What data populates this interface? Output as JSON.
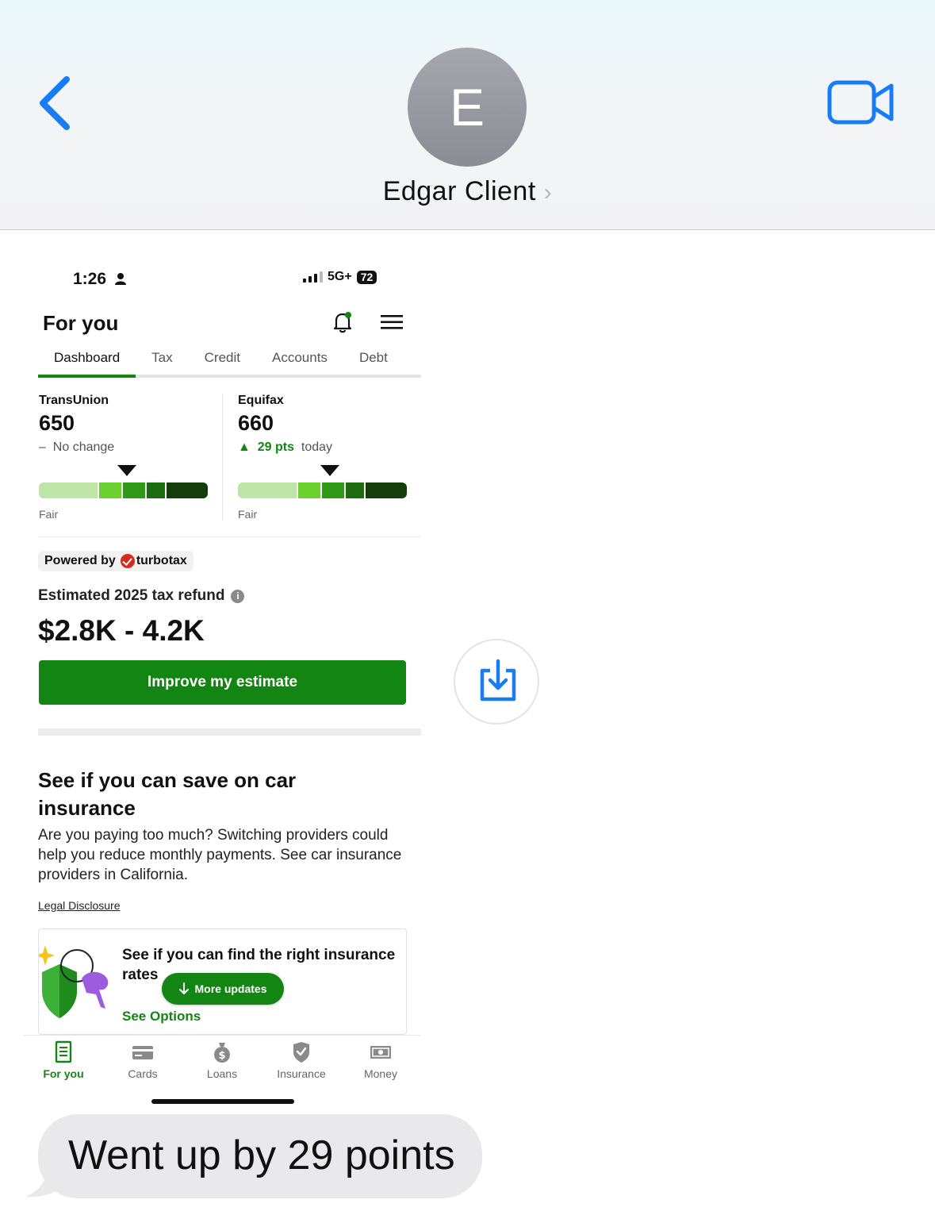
{
  "header": {
    "avatar_initial": "E",
    "contact_name": "Edgar Client",
    "contact_chevron": "›"
  },
  "status_bar": {
    "time": "1:26",
    "network": "5G+",
    "battery": "72"
  },
  "app": {
    "title": "For you",
    "tabs": [
      "Dashboard",
      "Tax",
      "Credit",
      "Accounts",
      "Debt"
    ],
    "active_tab": "Dashboard"
  },
  "credit": {
    "transunion": {
      "name": "TransUnion",
      "score": "650",
      "change_symbol": "–",
      "change_text": "No change",
      "rating": "Fair"
    },
    "equifax": {
      "name": "Equifax",
      "score": "660",
      "change_symbol": "▲",
      "change_value": "29 pts",
      "change_when": "today",
      "rating": "Fair"
    },
    "gauge_colors": [
      "#bde5a8",
      "#6ad12f",
      "#2f9a17",
      "#1d6b10",
      "#143d0b"
    ]
  },
  "tax": {
    "powered_by": "Powered by",
    "brand": "turbotax",
    "refund_label": "Estimated 2025 tax refund",
    "info_glyph": "i",
    "refund_value": "$2.8K - 4.2K",
    "improve_button": "Improve my estimate"
  },
  "insurance": {
    "title": "See if you can save on car insurance",
    "body": "Are you paying too much? Switching providers could help you reduce monthly payments. See car insurance providers in California.",
    "legal_link": "Legal Disclosure",
    "promo_title": "See if you can find the right insurance rates",
    "see_options": "See Options",
    "more_updates": "More updates"
  },
  "bottom_nav": [
    {
      "label": "For you",
      "icon": "document-icon",
      "active": true
    },
    {
      "label": "Cards",
      "icon": "card-icon",
      "active": false
    },
    {
      "label": "Loans",
      "icon": "money-bag-icon",
      "active": false
    },
    {
      "label": "Insurance",
      "icon": "shield-check-icon",
      "active": false
    },
    {
      "label": "Money",
      "icon": "cash-icon",
      "active": false
    }
  ],
  "message": {
    "text": "Went up by 29 points"
  },
  "colors": {
    "accent_green": "#138512",
    "ios_blue": "#1a7cf5",
    "bubble_gray": "#e9e9eb"
  }
}
